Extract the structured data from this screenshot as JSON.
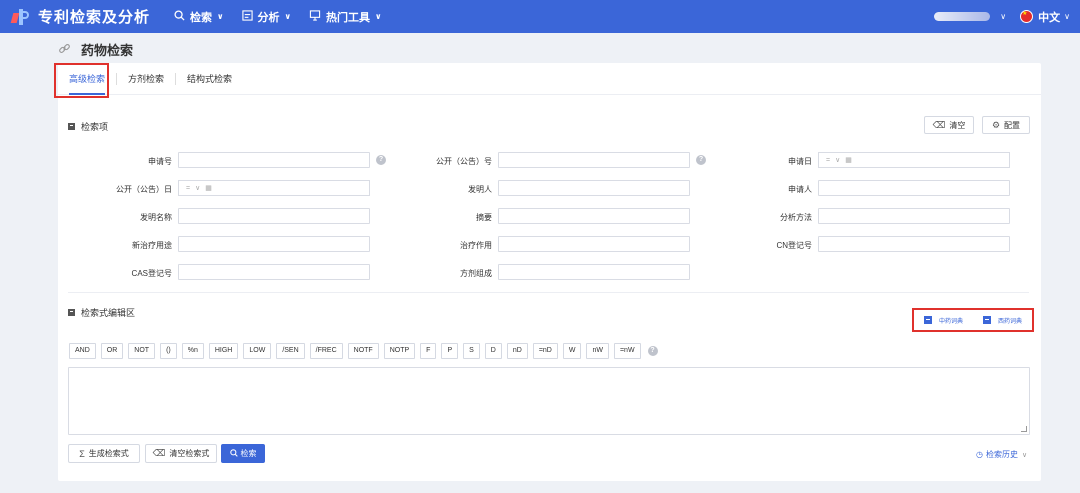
{
  "header": {
    "app_title": "专利检索及分析",
    "nav": [
      {
        "icon": "search-icon",
        "label": "检索"
      },
      {
        "icon": "chart-icon",
        "label": "分析"
      },
      {
        "icon": "monitor-icon",
        "label": "热门工具"
      }
    ],
    "language": "中文",
    "colors": {
      "brand": "#3b66d8",
      "highlight": "#e0312c"
    }
  },
  "page": {
    "title": "药物检索",
    "tabs": [
      {
        "label": "高级检索",
        "active": true
      },
      {
        "label": "方剂检索",
        "active": false
      },
      {
        "label": "结构式检索",
        "active": false
      }
    ]
  },
  "search_fields": {
    "section_title": "检索项",
    "clear_label": "清空",
    "config_label": "配置",
    "row1": {
      "application_no": "申请号",
      "publication_no": "公开（公告）号",
      "application_date": "申请日"
    },
    "row2": {
      "publication_date": "公开（公告）日",
      "inventor": "发明人",
      "applicant": "申请人"
    },
    "row3": {
      "invention_title": "发明名称",
      "abstract": "摘要",
      "analysis_method": "分析方法"
    },
    "row4": {
      "new_use": "新治疗用途",
      "therapeutic_effect": "治疗作用",
      "cn_reg_no": "CN登记号"
    },
    "row5": {
      "cas_reg_no": "CAS登记号",
      "formula_composition": "方剂组成"
    },
    "date_operator": "="
  },
  "editor": {
    "section_title": "检索式编辑区",
    "dict_tcm": "中药词典",
    "dict_western": "西药词典",
    "operators": [
      "AND",
      "OR",
      "NOT",
      "()",
      "%n",
      "HIGH",
      "LOW",
      "/SEN",
      "/FREC",
      "NOTF",
      "NOTP",
      "F",
      "P",
      "S",
      "D",
      "nD",
      "=nD",
      "W",
      "nW",
      "=nW"
    ],
    "generate_label": "生成检索式",
    "clear_expr_label": "清空检索式",
    "search_label": "检索",
    "history_label": "检索历史"
  }
}
